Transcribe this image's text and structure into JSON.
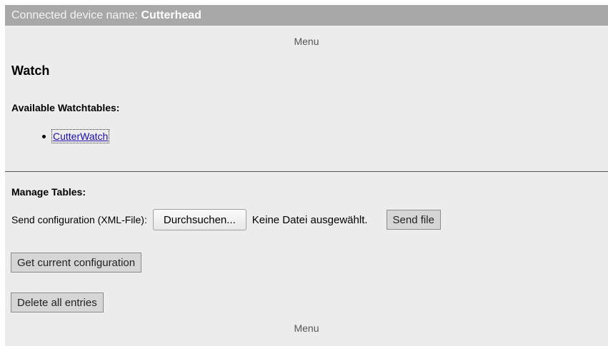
{
  "header": {
    "device_label": "Connected device name:",
    "device_name": "Cutterhead"
  },
  "menu": {
    "top_label": "Menu",
    "bottom_label": "Menu"
  },
  "page": {
    "title": "Watch"
  },
  "watchtables": {
    "heading": "Available Watchtables:",
    "items": [
      {
        "label": "CutterWatch"
      }
    ]
  },
  "manage": {
    "heading": "Manage Tables:",
    "send_label": "Send configuration (XML-File):",
    "browse_button": "Durchsuchen...",
    "file_status": "Keine Datei ausgewählt.",
    "send_button": "Send file",
    "get_button": "Get current configuration",
    "delete_button": "Delete all entries"
  }
}
